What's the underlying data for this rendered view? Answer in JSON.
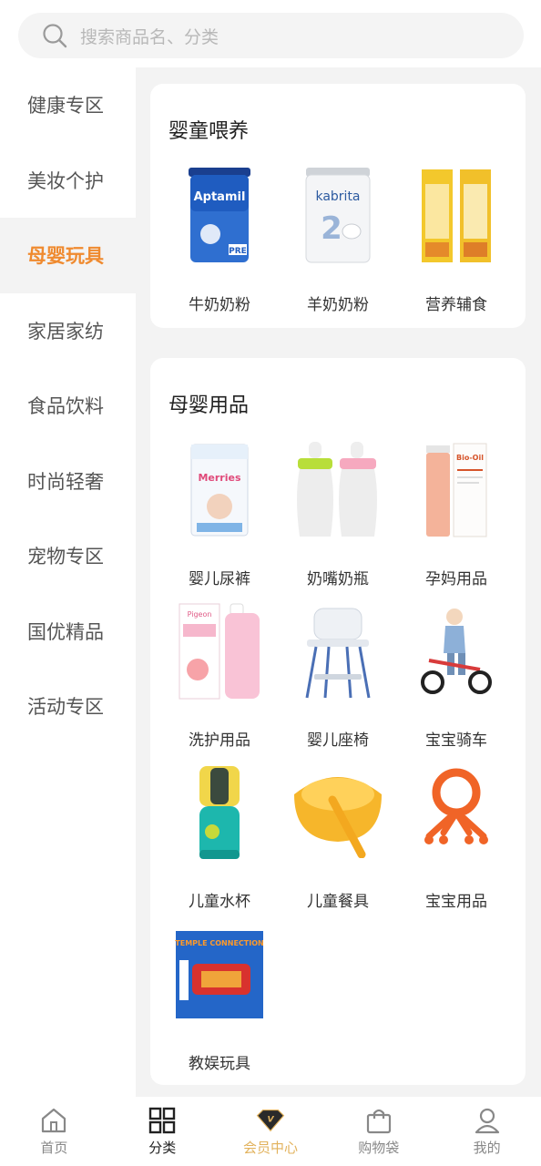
{
  "search": {
    "placeholder": "搜索商品名、分类"
  },
  "sidebar": {
    "items": [
      {
        "label": "健康专区"
      },
      {
        "label": "美妆个护"
      },
      {
        "label": "母婴玩具"
      },
      {
        "label": "家居家纺"
      },
      {
        "label": "食品饮料"
      },
      {
        "label": "时尚轻奢"
      },
      {
        "label": "宠物专区"
      },
      {
        "label": "国优精品"
      },
      {
        "label": "活动专区"
      }
    ],
    "active_index": 2
  },
  "sections": [
    {
      "title": "婴童喂养",
      "items": [
        {
          "label": "牛奶奶粉",
          "image": "aptamil-milk-powder-can",
          "brand": "Aptamil",
          "mark": "PRE"
        },
        {
          "label": "羊奶奶粉",
          "image": "kabrita-goat-milk-can",
          "brand": "kabrita",
          "mark": "2"
        },
        {
          "label": "营养辅食",
          "image": "nutrition-cereal-boxes"
        }
      ]
    },
    {
      "title": "母婴用品",
      "items": [
        {
          "label": "婴儿尿裤",
          "image": "merries-diaper-pack",
          "brand": "Merries"
        },
        {
          "label": "奶嘴奶瓶",
          "image": "baby-bottles"
        },
        {
          "label": "孕妈用品",
          "image": "bio-oil-bottle-box",
          "brand": "Bio-Oil"
        },
        {
          "label": "洗护用品",
          "image": "pigeon-peach-lotion",
          "brand": "Pigeon"
        },
        {
          "label": "婴儿座椅",
          "image": "baby-high-chair"
        },
        {
          "label": "宝宝骑车",
          "image": "kid-balance-bike"
        },
        {
          "label": "儿童水杯",
          "image": "kids-water-cup"
        },
        {
          "label": "儿童餐具",
          "image": "kids-tableware-bowl"
        },
        {
          "label": "宝宝用品",
          "image": "teether-toy"
        },
        {
          "label": "教娱玩具",
          "image": "temple-connection-game-box",
          "brand": "TEMPLE CONNECTION"
        }
      ]
    }
  ],
  "bottom_nav": [
    {
      "label": "首页",
      "icon": "home-icon"
    },
    {
      "label": "分类",
      "icon": "grid-icon"
    },
    {
      "label": "会员中心",
      "icon": "vip-diamond-icon",
      "badge": "V"
    },
    {
      "label": "购物袋",
      "icon": "shopping-bag-icon"
    },
    {
      "label": "我的",
      "icon": "user-icon"
    }
  ],
  "colors": {
    "accent": "#ef8a2f",
    "vip": "#e2b25c",
    "background": "#f3f3f3"
  }
}
